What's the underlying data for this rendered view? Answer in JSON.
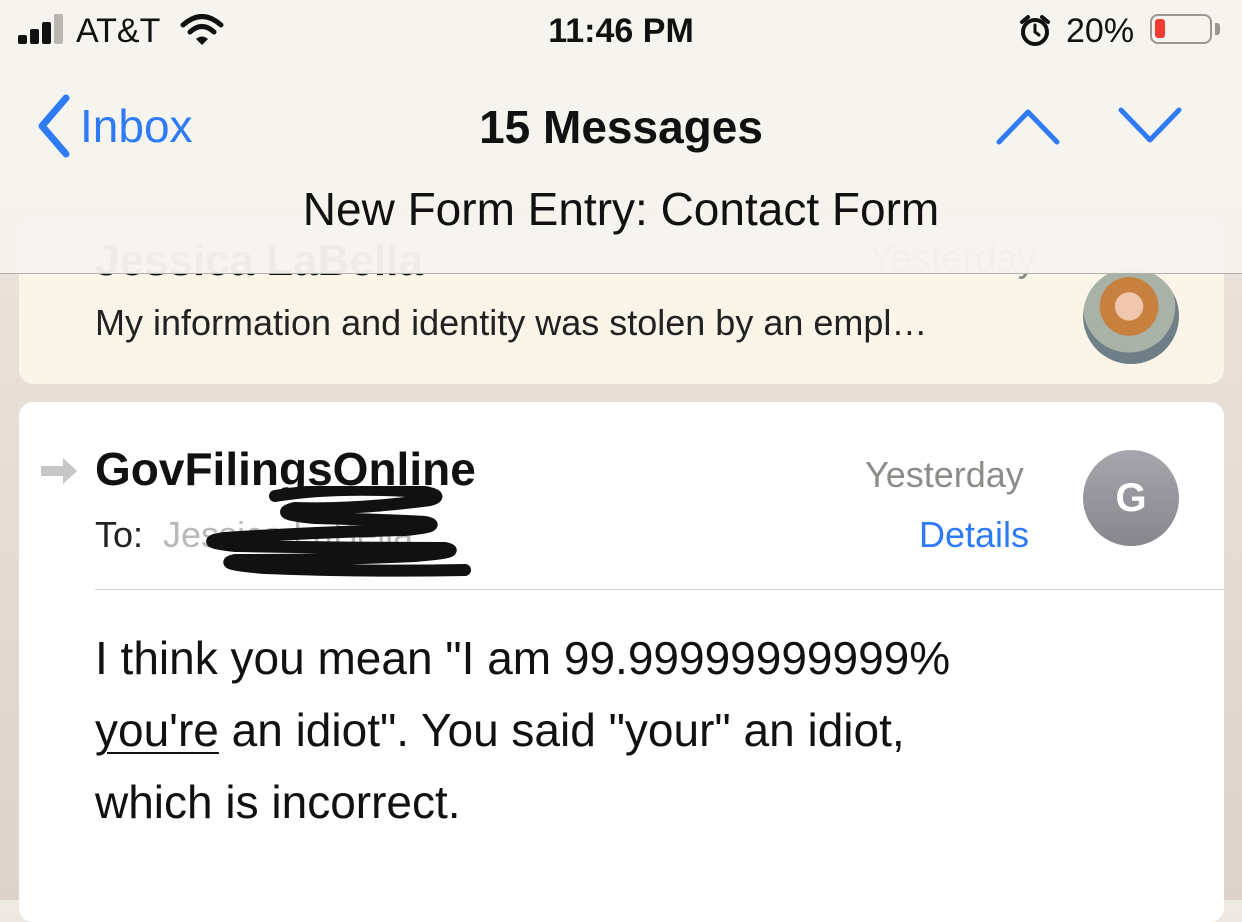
{
  "status_bar": {
    "carrier": "AT&T",
    "time": "11:46 PM",
    "battery_percent": "20%",
    "battery_level": 0.2,
    "signal_bars_filled": 3,
    "signal_bars_total": 4
  },
  "header": {
    "back_label": "Inbox",
    "title": "15 Messages",
    "subject": "New Form Entry: Contact Form"
  },
  "previous_message": {
    "sender": "Jessica LaBella",
    "date": "Yesterday",
    "snippet": "My information and identity was stolen by an empl…"
  },
  "message": {
    "sender": "GovFilingsOnline",
    "date": "Yesterday",
    "to_label": "To:",
    "to_value": "Jessica LaBella",
    "details_label": "Details",
    "avatar_initial": "G",
    "body_line1": "I think you mean \"I am 99.99999999999%",
    "body_underlined": "you're",
    "body_line2_rest": " an idiot\". You said \"your\" an idiot,",
    "body_line3": "which is incorrect."
  },
  "colors": {
    "accent": "#2f7bf6",
    "battery_low": "#ef3b32",
    "avatar_gray": "#96969c"
  },
  "icons": [
    "signal-icon",
    "wifi-icon",
    "alarm-icon",
    "battery-icon",
    "back-chevron-icon",
    "chevron-up-icon",
    "chevron-down-icon",
    "reply-arrow-icon"
  ]
}
